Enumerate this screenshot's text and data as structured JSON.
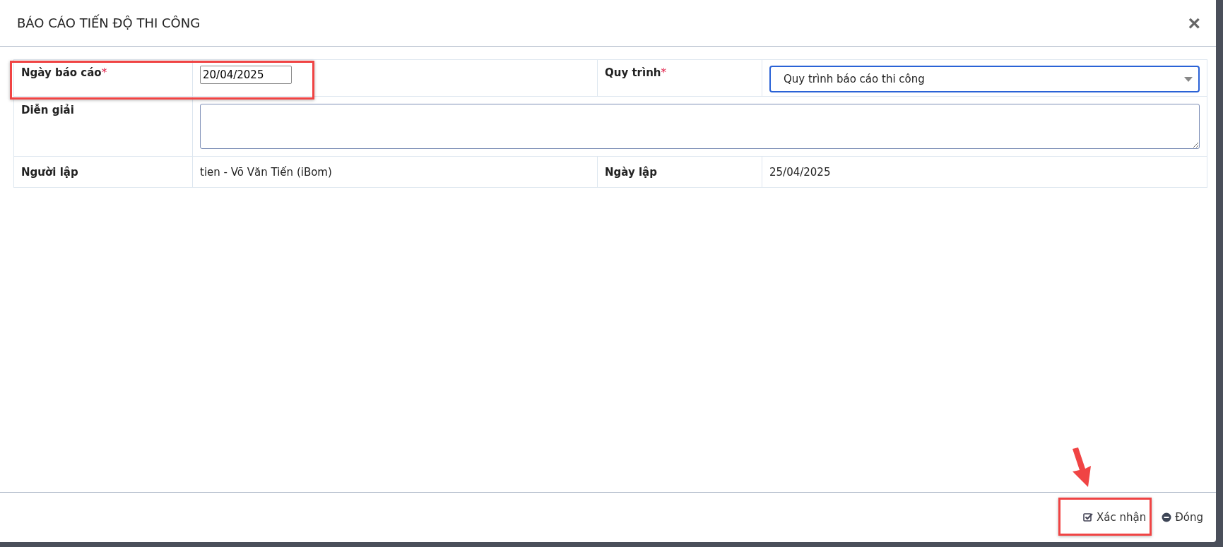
{
  "dialog": {
    "title": "BÁO CÁO TIẾN ĐỘ THI CÔNG",
    "close": "×"
  },
  "form": {
    "report_date": {
      "label": "Ngày báo cáo",
      "required_mark": "*",
      "value": "20/04/2025"
    },
    "process": {
      "label": "Quy trình",
      "required_mark": "*",
      "value": "Quy trình báo cáo thi công"
    },
    "description": {
      "label": "Diễn giải"
    },
    "creator": {
      "label": "Người lập",
      "value": "tien - Võ Văn Tiến (iBom)"
    },
    "created_date": {
      "label": "Ngày lập",
      "value": "25/04/2025"
    }
  },
  "buttons": [
    {
      "kind": "confirm",
      "label": "Xác nhận"
    },
    {
      "kind": "close",
      "label": "Đóng"
    }
  ]
}
